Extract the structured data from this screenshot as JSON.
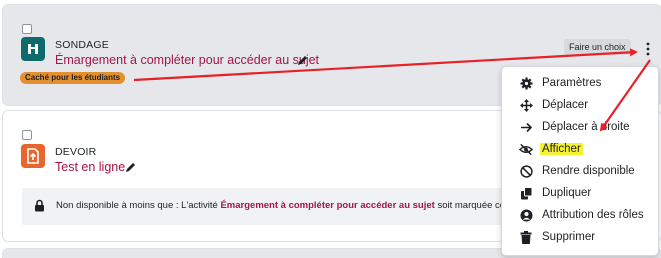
{
  "activity_hidden": {
    "type_label": "SONDAGE",
    "name": "Émargement à compléter pour accéder au sujet",
    "badge": "Caché pour les étudiants",
    "action_button": "Faire un choix"
  },
  "activity_assign": {
    "type_label": "DEVOIR",
    "name": "Test en ligne",
    "restriction": {
      "prefix": "Non disponible à moins que : L'activité",
      "link": "Émargement à compléter pour accéder au sujet",
      "suffix": "soit marquée cor"
    }
  },
  "menu": {
    "items": [
      {
        "label": "Paramètres",
        "icon": "gear-icon"
      },
      {
        "label": "Déplacer",
        "icon": "move-icon"
      },
      {
        "label": "Déplacer à droite",
        "icon": "arrow-right-icon"
      },
      {
        "label": "Afficher",
        "icon": "eye-slash-icon",
        "highlighted": true
      },
      {
        "label": "Rendre disponible",
        "icon": "ban-icon"
      },
      {
        "label": "Dupliquer",
        "icon": "copy-icon"
      },
      {
        "label": "Attribution des rôles",
        "icon": "user-circle-icon"
      },
      {
        "label": "Supprimer",
        "icon": "trash-icon"
      }
    ]
  },
  "colors": {
    "activity_link": "#a31645",
    "badge_hidden": "#e5902e",
    "highlight": "#f5f234",
    "annotation_arrow": "#e8202a"
  }
}
